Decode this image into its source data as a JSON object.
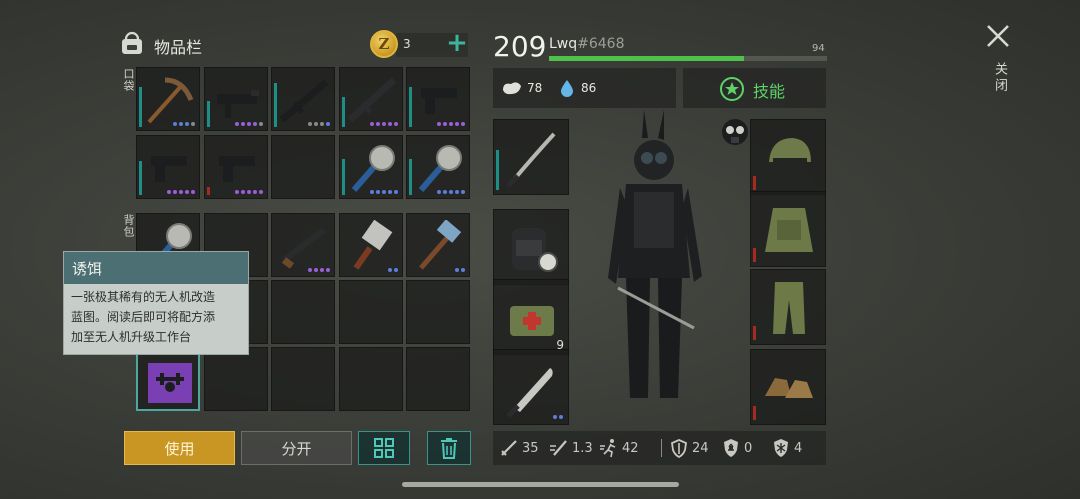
{
  "inventory": {
    "title": "物品栏",
    "coin_symbol": "Z",
    "coin_count": "3",
    "add_label": "+",
    "pocket_label": "口袋",
    "backpack_label": "背包"
  },
  "tooltip": {
    "title": "诱饵",
    "line1": "一张极其稀有的无人机改造",
    "line2": "蓝图。阅读后即可将配方添",
    "line3": "加至无人机升级工作台"
  },
  "actions": {
    "use_label": "使用",
    "split_label": "分开"
  },
  "player": {
    "level": "209",
    "name": "Lwq",
    "tag": "#6468",
    "xp_value": "94",
    "xp_fraction": 0.7,
    "food": "78",
    "water": "86",
    "skills_label": "技能"
  },
  "equipment": {
    "medkit_count": "9"
  },
  "stats": {
    "damage": "35",
    "attack_speed": "1.3",
    "move_speed": "42",
    "armor": "24",
    "radiation": "0",
    "cold": "4"
  },
  "window": {
    "close_label": "关闭"
  },
  "colors": {
    "accent_teal": "#3a938a",
    "use_gold": "#c99624",
    "xp_green": "#4fc14a",
    "durability_teal": "#1f8e85",
    "durability_red": "#a62a22"
  }
}
